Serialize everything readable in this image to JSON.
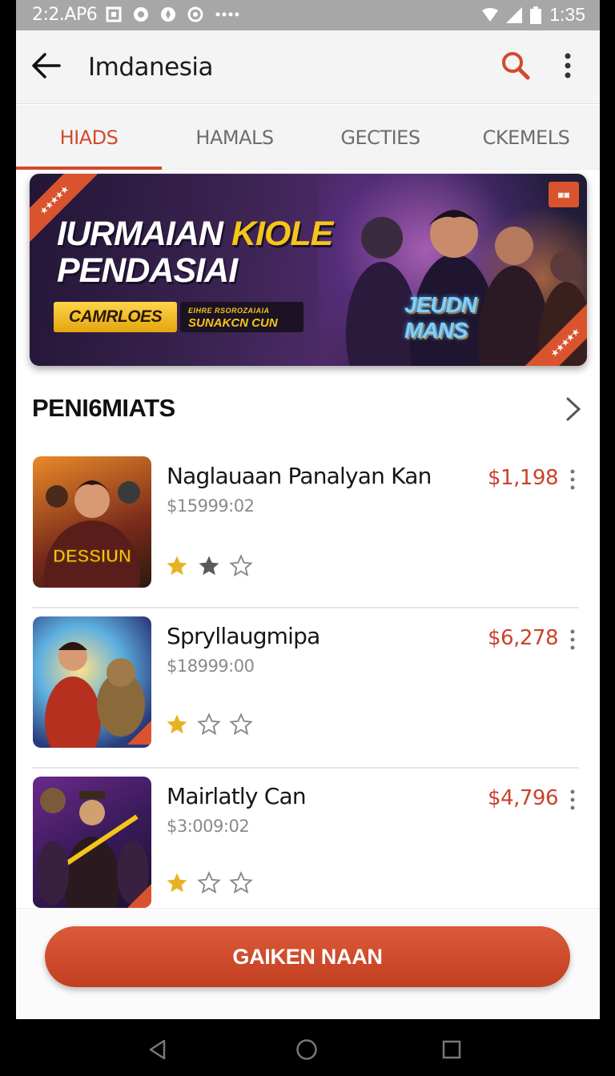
{
  "status_bar": {
    "left_text": "2:2.AP6",
    "clock": "1:35",
    "icons": [
      "sim-icon",
      "app-icon",
      "location-icon",
      "record-icon",
      "more-dots-icon",
      "wifi-icon",
      "signal-icon",
      "battery-icon"
    ]
  },
  "app_bar": {
    "title": "Imdanesia",
    "back_icon": "arrow-left-icon",
    "search_icon": "search-icon",
    "menu_icon": "more-vertical-icon"
  },
  "tabs": [
    {
      "label": "HIADS",
      "active": true
    },
    {
      "label": "HAMALS",
      "active": false
    },
    {
      "label": "GECTIES",
      "active": false
    },
    {
      "label": "CKEMELS",
      "active": false
    }
  ],
  "banner": {
    "title_line1_white": "IURMAIAN ",
    "title_line1_gold": "KIOLE",
    "title_line2": "PENDASIAI",
    "cta_label": "CAMRLOES",
    "sub_small": "EIHRE RSOROZAIAIA",
    "sub_main": "SUNAKCN CUN",
    "logo_text": "JEUDN MANS"
  },
  "section": {
    "title": "PENI6MIATS",
    "more_icon": "chevron-right-icon"
  },
  "items": [
    {
      "name": "Naglauaan Panalyan Kan",
      "subtitle": "$15999:02",
      "price": "$1,198",
      "rating": 2,
      "thumb_text": "DESSIUN"
    },
    {
      "name": "Spryllaugmipa",
      "subtitle": "$18999:00",
      "price": "$6,278",
      "rating": 1,
      "thumb_text": ""
    },
    {
      "name": "Mairlatly Can",
      "subtitle": "$3:009:02",
      "price": "$4,796",
      "rating": 1,
      "thumb_text": ""
    }
  ],
  "primary_button": {
    "label": "GAIKEN NAAN"
  },
  "colors": {
    "accent": "#d14a2c",
    "price": "#c9432a",
    "star_filled": "#e6b422",
    "star_dark": "#5a5a5a",
    "status_bar": "#a7a7a7"
  }
}
